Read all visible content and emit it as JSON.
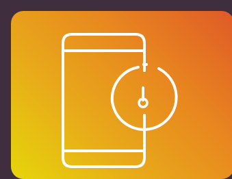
{
  "tile": {
    "background_gradient": [
      "#e6d60a",
      "#e8a81a",
      "#e8871f",
      "#df5a27"
    ],
    "frame_color": "#3f2f3e"
  },
  "icon": {
    "name": "phone-timer-icon",
    "stroke_color": "#ffffff"
  }
}
